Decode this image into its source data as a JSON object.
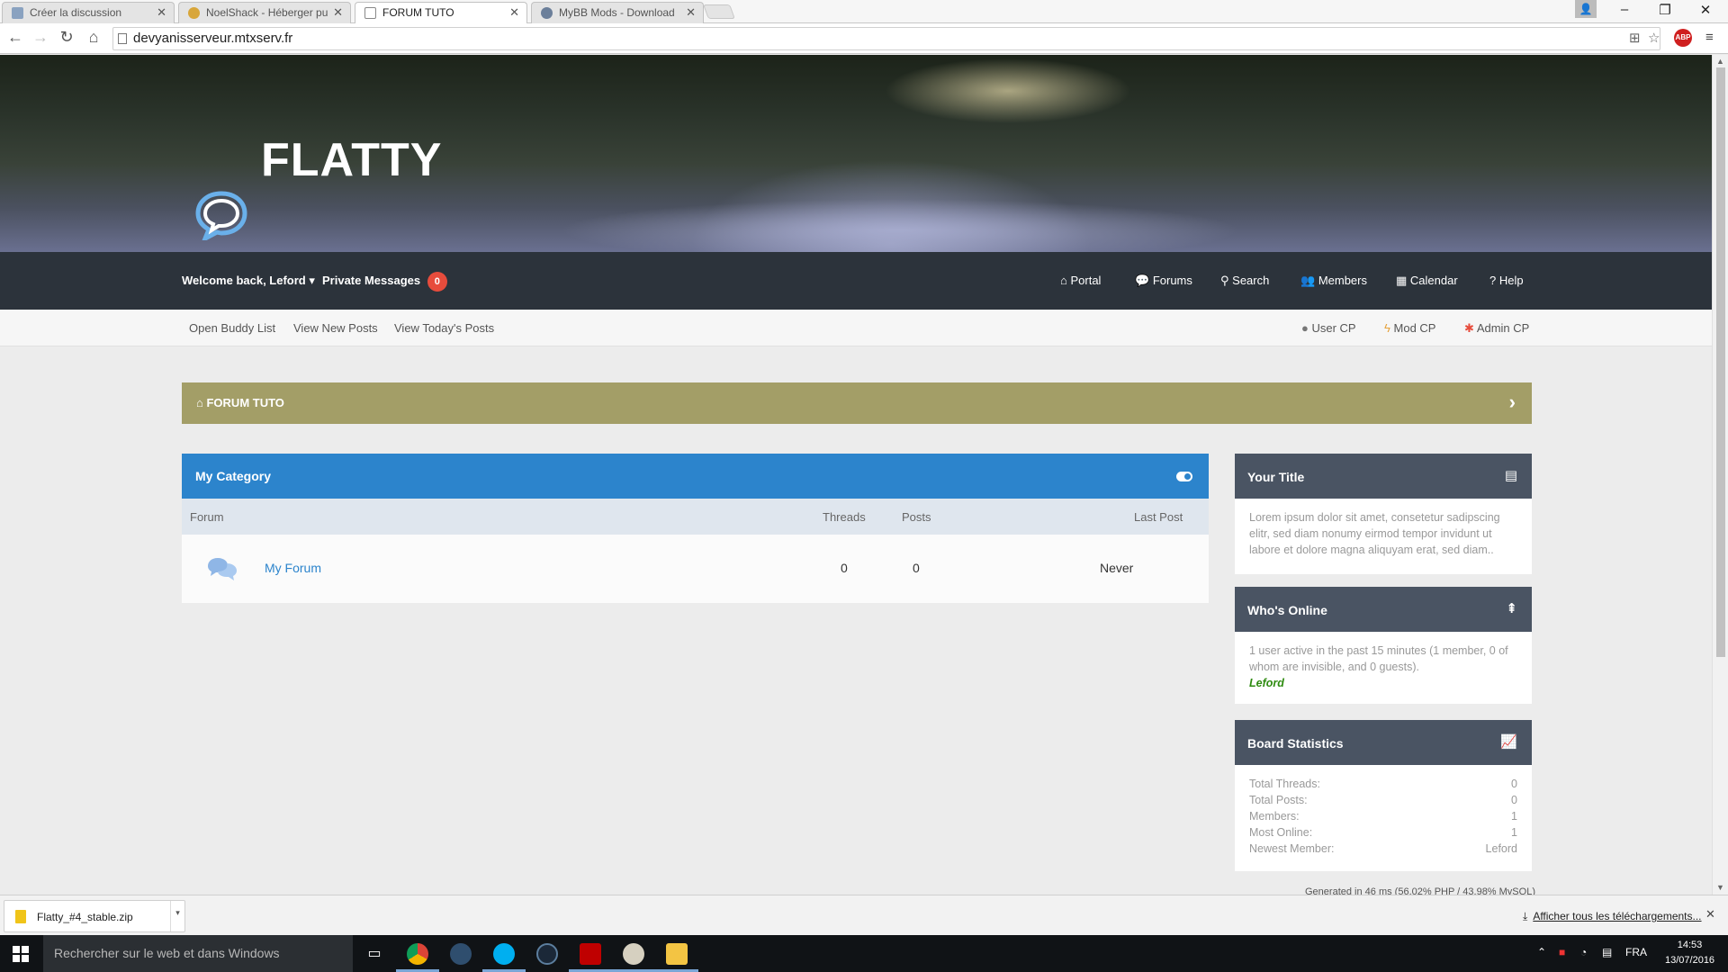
{
  "browser": {
    "tabs": [
      {
        "title": "Créer la discussion",
        "active": false
      },
      {
        "title": "NoelShack - Héberger pu",
        "active": false
      },
      {
        "title": "FORUM TUTO",
        "active": true
      },
      {
        "title": "MyBB Mods - Download",
        "active": false
      }
    ],
    "url": "devyanisserveur.mtxserv.fr"
  },
  "header": {
    "logo_text": "FLATTY"
  },
  "navbar": {
    "welcome": "Welcome back, Leford",
    "pm_label": "Private Messages",
    "pm_count": "0",
    "menu": [
      "Portal",
      "Forums",
      "Search",
      "Members",
      "Calendar",
      "Help"
    ]
  },
  "subnav": {
    "left": [
      "Open Buddy List",
      "View New Posts",
      "View Today's Posts"
    ],
    "right": [
      "User CP",
      "Mod CP",
      "Admin CP"
    ]
  },
  "breadcrumb": {
    "label": "FORUM TUTO"
  },
  "category": {
    "title": "My Category",
    "columns": [
      "Forum",
      "Threads",
      "Posts",
      "Last Post"
    ],
    "forums": [
      {
        "name": "My Forum",
        "threads": "0",
        "posts": "0",
        "last_post": "Never"
      }
    ]
  },
  "sidebar": {
    "your_title": {
      "title": "Your Title",
      "body": "Lorem ipsum dolor sit amet, consetetur sadipscing elitr, sed diam nonumy eirmod tempor invidunt ut labore et dolore magna aliquyam erat, sed diam.."
    },
    "whos_online": {
      "title": "Who's Online",
      "body": "1 user active in the past 15 minutes (1 member, 0 of whom are invisible, and 0 guests).",
      "user": "Leford"
    },
    "board_stats": {
      "title": "Board Statistics",
      "rows": [
        {
          "label": "Total Threads:",
          "value": "0"
        },
        {
          "label": "Total Posts:",
          "value": "0"
        },
        {
          "label": "Members:",
          "value": "1"
        },
        {
          "label": "Most Online:",
          "value": "1"
        },
        {
          "label": "Newest Member:",
          "value": "Leford"
        }
      ]
    }
  },
  "footer": {
    "generated": "Generated in 46 ms (56.02% PHP / 43.98% MySQL)"
  },
  "downloads": {
    "file": "Flatty_#4_stable.zip",
    "show_all": "Afficher tous les téléchargements..."
  },
  "taskbar": {
    "search_placeholder": "Rechercher sur le web et dans Windows",
    "language": "FRA",
    "time": "14:53",
    "date": "13/07/2016"
  },
  "colors": {
    "navbar": "#2c333b",
    "breadcrumb": "#a39e67",
    "category_header": "#2c84cc",
    "sidebar_header": "#4a5463",
    "badge": "#e74c3c",
    "online_user": "#2e8b10"
  }
}
